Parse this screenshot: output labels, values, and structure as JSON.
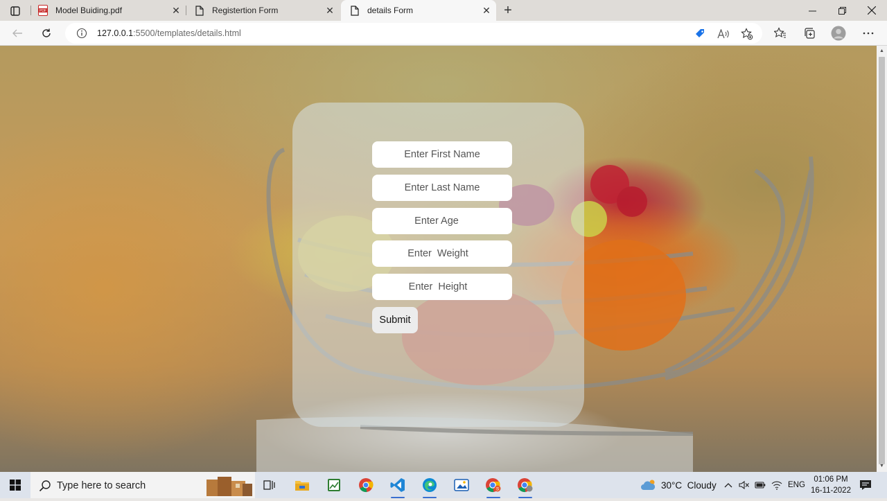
{
  "browser": {
    "tabs": [
      {
        "title": "Model Buiding.pdf",
        "icon": "pdf-icon",
        "active": false
      },
      {
        "title": "Registertion Form",
        "icon": "page-icon",
        "active": false
      },
      {
        "title": "details Form",
        "icon": "page-icon",
        "active": true
      }
    ],
    "url_host": "127.0.0.1",
    "url_path": ":5500/templates/details.html"
  },
  "form": {
    "first_name_placeholder": "Enter First Name",
    "last_name_placeholder": "Enter Last Name",
    "age_placeholder": "Enter Age",
    "weight_placeholder": "Enter  Weight",
    "height_placeholder": "Enter  Height",
    "submit_label": "Submit"
  },
  "taskbar": {
    "search_placeholder": "Type here to search",
    "weather": "30°C  Cloudy",
    "language": "ENG",
    "time": "01:06 PM",
    "date": "16-11-2022"
  }
}
